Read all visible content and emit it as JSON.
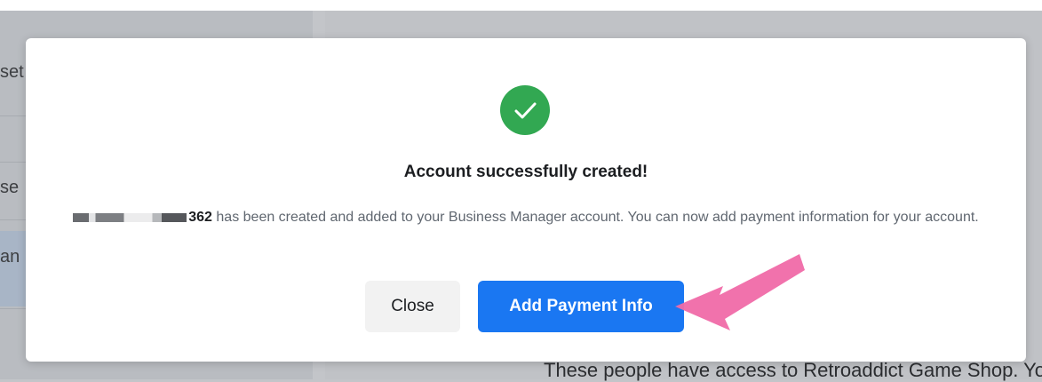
{
  "background": {
    "left_peek_texts": [
      "set",
      "se",
      "an"
    ],
    "bottom_peek_text": "These people have access to Retroaddict Game Shop. Yo"
  },
  "modal": {
    "title": "Account successfully created!",
    "account_id_suffix": "362",
    "message": " has been created and added to your Business Manager account. You can now add payment information for your account.",
    "icon": "check-circle-icon",
    "buttons": {
      "close_label": "Close",
      "primary_label": "Add Payment Info"
    }
  },
  "colors": {
    "success": "#32a852",
    "primary": "#1a77f2",
    "annotation_arrow": "#f06aa8"
  }
}
